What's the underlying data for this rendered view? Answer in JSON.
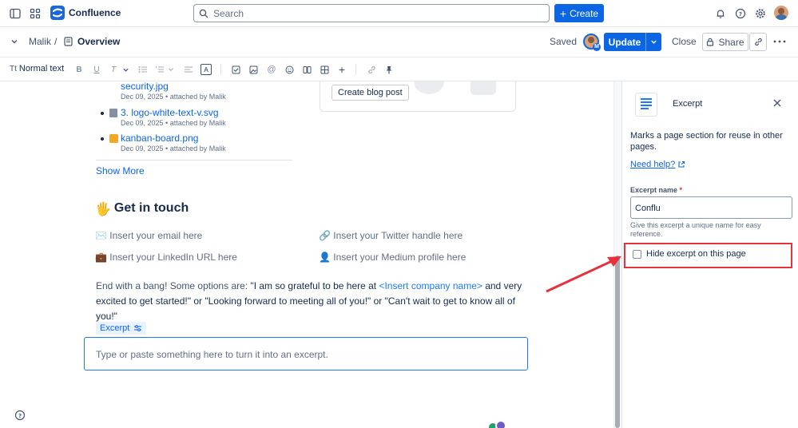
{
  "app": {
    "name": "Confluence"
  },
  "topbar": {
    "search_placeholder": "Search",
    "create_label": "Create"
  },
  "subbar": {
    "space": "Malik",
    "separator": "/",
    "page_title": "Overview",
    "saved_status": "Saved",
    "update_label": "Update",
    "close_label": "Close",
    "share_label": "Share",
    "avatar_badge": "M"
  },
  "toolbar": {
    "text_style": "Normal text"
  },
  "editor": {
    "attachments": [
      {
        "name": "security.jpg",
        "meta": "Dec 09, 2025 • attached by Malik"
      },
      {
        "name": "3. logo-white-text-v.svg",
        "meta": "Dec 09, 2025 • attached by Malik"
      },
      {
        "name": "kanban-board.png",
        "meta": "Dec 09, 2025 • attached by Malik"
      }
    ],
    "show_more": "Show More",
    "create_blog_post": "Create blog post",
    "get_in_touch": {
      "emoji": "🖐",
      "heading": "Get in touch"
    },
    "contacts": [
      {
        "emoji": "✉️",
        "text": "Insert your email here"
      },
      {
        "emoji": "🔗",
        "text": "Insert your Twitter handle here"
      },
      {
        "emoji": "💼",
        "text": "Insert your LinkedIn URL here"
      },
      {
        "emoji": "👤",
        "text": "Insert your Medium profile here"
      }
    ],
    "closing": {
      "before": "End with a bang! Some options are: ",
      "quote1": "\"I am so grateful to be here at ",
      "placeholder": "<Insert company name>",
      "after": " and very excited to get started!\" or \"Looking forward to meeting all of you!\" or \"Can't wait to get to know all of you!\""
    },
    "excerpt_tag": "Excerpt",
    "excerpt_placeholder": "Type or paste something here to turn it into an excerpt."
  },
  "panel": {
    "title": "Excerpt",
    "description": "Marks a page section for reuse in other pages.",
    "help_link": "Need help?",
    "field_label": "Excerpt name",
    "required_mark": "*",
    "field_value": "Conflu",
    "field_hint": "Give this excerpt a unique name for easy reference.",
    "checkbox_label": "Hide excerpt on this page",
    "checkbox_checked": false
  },
  "colors": {
    "brand": "#0c66e4",
    "annotation": "#e5323b"
  }
}
